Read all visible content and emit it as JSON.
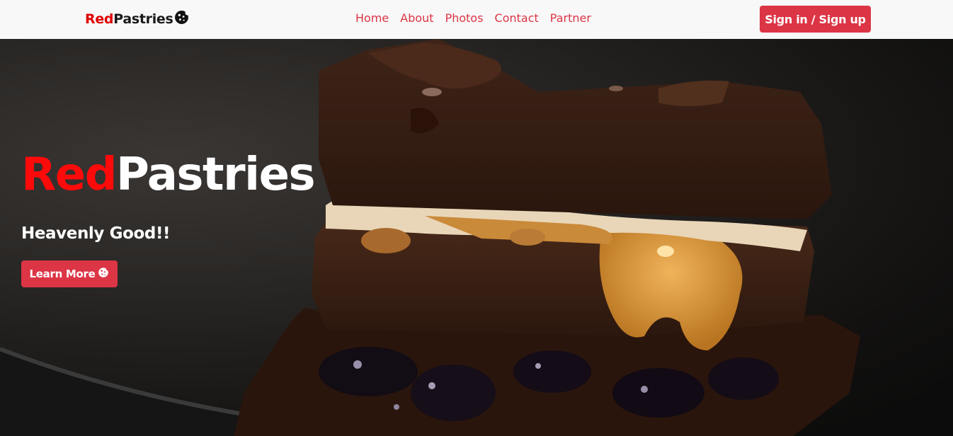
{
  "brand": {
    "red_part": "Red",
    "dark_part": "Pastries",
    "icon": "cookie-icon"
  },
  "nav": {
    "items": [
      {
        "label": "Home"
      },
      {
        "label": "About"
      },
      {
        "label": "Photos"
      },
      {
        "label": "Contact"
      },
      {
        "label": "Partner"
      }
    ],
    "signin_label": "Sign in / Sign up"
  },
  "hero": {
    "title_red": "Red",
    "title_white": "Pastries",
    "tagline": "Heavenly Good!!",
    "cta_label": "Learn More",
    "cta_icon": "cookie-icon",
    "image_subject": "chocolate-brownie-photo"
  },
  "colors": {
    "accent": "#dc3545",
    "brand_red": "#ff0a0a",
    "navbar_bg": "#f8f8f8"
  }
}
